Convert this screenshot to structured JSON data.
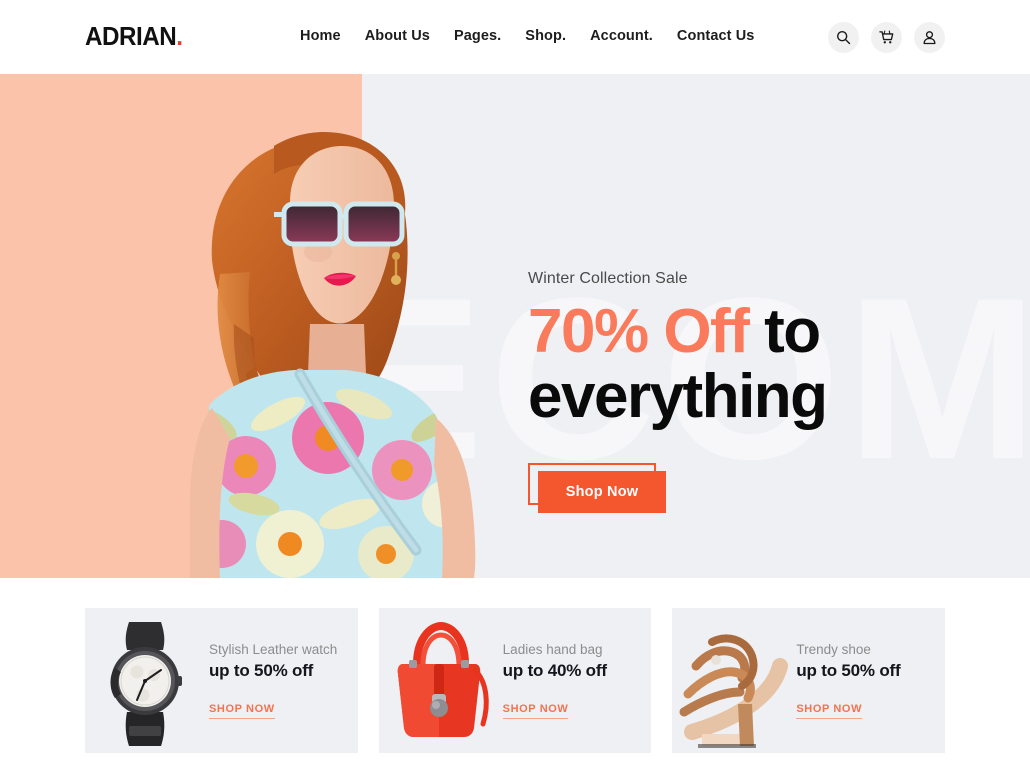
{
  "header": {
    "logo_text": "ADRIAN",
    "logo_dot": ".",
    "nav": [
      {
        "label": "Home"
      },
      {
        "label": "About Us"
      },
      {
        "label": "Pages."
      },
      {
        "label": "Shop."
      },
      {
        "label": "Account."
      },
      {
        "label": "Contact Us"
      }
    ],
    "icons": [
      {
        "name": "search-icon",
        "label": "Search"
      },
      {
        "name": "cart-icon",
        "label": "Cart"
      },
      {
        "name": "user-icon",
        "label": "Account"
      }
    ]
  },
  "hero": {
    "watermark_text": "ECOM",
    "kicker": "Winter Collection Sale",
    "headline_accent": "70% Off",
    "headline_rest": " to",
    "headline_line2": "everything",
    "cta_label": "Shop Now",
    "panel_color": "#fbc4aa",
    "background_color": "#eff0f3",
    "accent_color": "#f97b5c",
    "button_color": "#f4562e",
    "model_alt": "Woman with red hair wearing sunglasses and floral dress"
  },
  "promos": [
    {
      "image_name": "wristwatch-image",
      "subtitle": "Stylish Leather watch",
      "title": "up to 50% off",
      "cta": "SHOP NOW"
    },
    {
      "image_name": "handbag-image",
      "subtitle": "Ladies hand bag",
      "title": "up to 40% off",
      "cta": "SHOP NOW"
    },
    {
      "image_name": "heeled-sandal-image",
      "subtitle": "Trendy shoe",
      "title": "up to 50% off",
      "cta": "SHOP NOW"
    }
  ]
}
